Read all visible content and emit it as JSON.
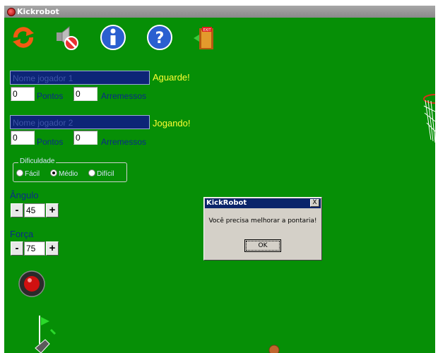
{
  "window": {
    "title": "Kickrobot"
  },
  "toolbar": {
    "icons": [
      "restart-icon",
      "sound-off-icon",
      "info-icon",
      "help-icon",
      "exit-icon"
    ],
    "exit_sign": "EXIT"
  },
  "player1": {
    "name_placeholder": "Nome jogador 1",
    "status": "Aguarde!",
    "points": "0",
    "points_label": "Pontos",
    "throws": "0",
    "throws_label": "Arremessos"
  },
  "player2": {
    "name_placeholder": "Nome jogador 2",
    "status": "Jogando!",
    "points": "0",
    "points_label": "Pontos",
    "throws": "0",
    "throws_label": "Arremessos"
  },
  "difficulty": {
    "legend": "Dificuldade",
    "options": [
      {
        "label": "Fácil",
        "selected": false
      },
      {
        "label": "Médio",
        "selected": true
      },
      {
        "label": "Difícil",
        "selected": false
      }
    ]
  },
  "angle": {
    "label": "Ângulo",
    "minus": "-",
    "plus": "+",
    "value": "45"
  },
  "force": {
    "label": "Força",
    "minus": "-",
    "plus": "+",
    "value": "75"
  },
  "dialog": {
    "title": "KickRobot",
    "close": "X",
    "message": "Você precisa melhorar a pontaria!",
    "ok": "OK"
  },
  "colors": {
    "field": "#068f06",
    "name_field": "#0d2577",
    "status": "#ffff33",
    "label": "#0b2a8a"
  }
}
